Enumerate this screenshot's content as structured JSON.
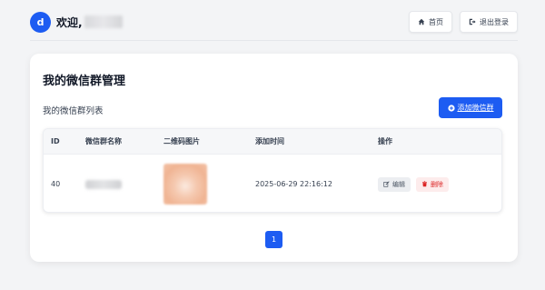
{
  "header": {
    "avatar_letter": "d",
    "welcome": "欢迎,",
    "home_label": "首页",
    "logout_label": "退出登录"
  },
  "card": {
    "title": "我的微信群管理",
    "list_label": "我的微信群列表",
    "add_label": "添加微信群"
  },
  "table": {
    "columns": [
      "ID",
      "微信群名称",
      "二维码图片",
      "添加时间",
      "操作"
    ],
    "rows": [
      {
        "id": "40",
        "time": "2025-06-29 22:16:12",
        "edit_label": "编辑",
        "delete_label": "删除"
      }
    ]
  },
  "pagination": {
    "current_page": "1"
  },
  "colors": {
    "primary": "#1d5cf2",
    "danger": "#dc2626",
    "background": "#f3f4f6"
  },
  "icons": [
    "home-icon",
    "logout-icon",
    "plus-circle-icon",
    "edit-icon",
    "trash-icon"
  ]
}
